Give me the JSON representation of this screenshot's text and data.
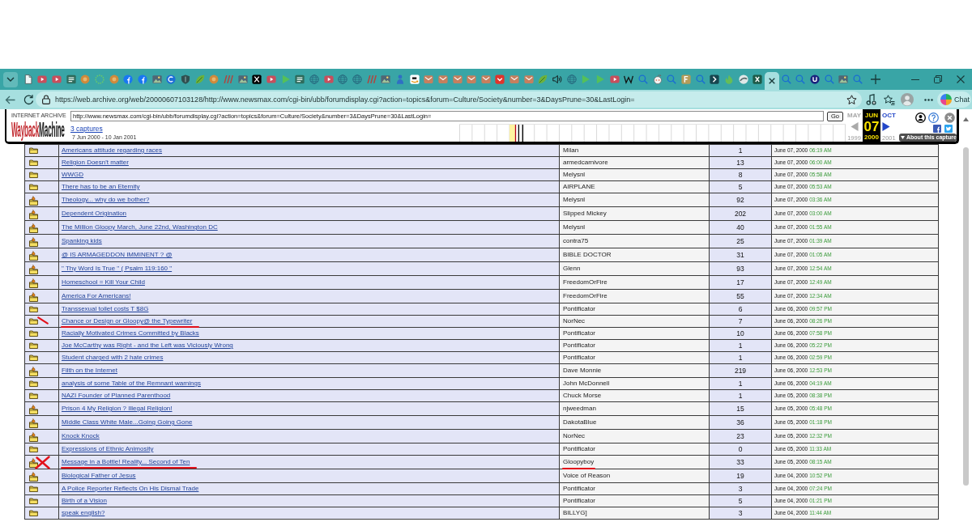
{
  "browser": {
    "tabs": [
      {
        "kind": "page",
        "selected": false
      },
      {
        "kind": "video",
        "selected": false
      },
      {
        "kind": "video",
        "selected": false
      },
      {
        "kind": "card",
        "selected": false
      },
      {
        "kind": "circle",
        "selected": false
      },
      {
        "kind": "dots",
        "selected": false
      },
      {
        "kind": "circle",
        "selected": false
      },
      {
        "kind": "f-circle",
        "selected": false
      },
      {
        "kind": "f-circle",
        "selected": false
      },
      {
        "kind": "image",
        "selected": false
      },
      {
        "kind": "ring",
        "selected": false
      },
      {
        "kind": "shield",
        "selected": false
      },
      {
        "kind": "leaf",
        "selected": false
      },
      {
        "kind": "circle",
        "selected": false
      },
      {
        "kind": "stripes",
        "selected": false
      },
      {
        "kind": "image",
        "selected": false
      },
      {
        "kind": "x",
        "selected": false
      },
      {
        "kind": "video",
        "selected": false
      },
      {
        "kind": "play",
        "selected": false
      },
      {
        "kind": "card",
        "selected": false
      },
      {
        "kind": "globe",
        "selected": false
      },
      {
        "kind": "video",
        "selected": false
      },
      {
        "kind": "globe",
        "selected": false
      },
      {
        "kind": "globe",
        "selected": false
      },
      {
        "kind": "stripes",
        "selected": false
      },
      {
        "kind": "image",
        "selected": false
      },
      {
        "kind": "person",
        "selected": false
      },
      {
        "kind": "smile-arrow",
        "selected": false
      },
      {
        "kind": "envelope",
        "selected": false
      },
      {
        "kind": "envelope",
        "selected": false
      },
      {
        "kind": "envelope",
        "selected": false
      },
      {
        "kind": "envelope",
        "selected": false
      },
      {
        "kind": "envelope",
        "selected": false
      },
      {
        "kind": "chevron",
        "selected": false
      },
      {
        "kind": "envelope",
        "selected": false
      },
      {
        "kind": "envelope",
        "selected": false
      },
      {
        "kind": "leaf",
        "selected": false
      },
      {
        "kind": "speaker",
        "selected": false
      },
      {
        "kind": "globe",
        "selected": false
      },
      {
        "kind": "play",
        "selected": false
      },
      {
        "kind": "play",
        "selected": false
      },
      {
        "kind": "video",
        "selected": false
      },
      {
        "kind": "w",
        "selected": false
      },
      {
        "kind": "search",
        "selected": false
      },
      {
        "kind": "face",
        "selected": false
      },
      {
        "kind": "search",
        "selected": false
      },
      {
        "kind": "f-square",
        "selected": false
      },
      {
        "kind": "search",
        "selected": false
      },
      {
        "kind": "arrow-box",
        "selected": false
      },
      {
        "kind": "flame",
        "selected": false
      },
      {
        "kind": "swoosh",
        "selected": false
      },
      {
        "kind": "x-box",
        "selected": false
      },
      {
        "selected": true
      },
      {
        "kind": "search",
        "selected": false
      },
      {
        "kind": "search",
        "selected": false
      },
      {
        "kind": "u-circle",
        "selected": false
      },
      {
        "kind": "search",
        "selected": false
      },
      {
        "kind": "image",
        "selected": false
      },
      {
        "kind": "search",
        "selected": false
      }
    ],
    "address": "https://web.archive.org/web/20000607103128/http://www.newsmax.com/cgi-bin/ubb/forumdisplay.cgi?action=topics&forum=Culture/Society&number=3&DaysPrune=30&LastLogin=",
    "chat": "Chat"
  },
  "wayback": {
    "logo": {
      "caption": "INTERNET ARCHIVE",
      "first": "Wayback",
      "second": "Machine"
    },
    "url": "http://www.newsmax.com/cgi-bin/ubb/forumdisplay.cgi?action=topics&forum=Culture/Society&number=3&DaysPrune=30&LastLogin=",
    "go": "Go",
    "captures": "3 captures",
    "range": "7 Jun 2000 - 10 Jan 2001",
    "prev": {
      "month": "MAY",
      "year": "1999",
      "enabled": false
    },
    "current": {
      "month": "JUN",
      "day": "07",
      "year": "2000"
    },
    "next": {
      "month": "OCT",
      "year": "2001",
      "enabled": true
    },
    "about": "About this capture"
  },
  "forum": {
    "topics": [
      {
        "kind": "folder",
        "title": "Americans attitude regarding races",
        "starter": "Milan",
        "replies": "1",
        "date": "June 07, 2000",
        "time": "06:19 AM",
        "underlined": false,
        "starter_underlined": false,
        "slashed": false,
        "crossed": false
      },
      {
        "kind": "folder",
        "title": "Religion Doesn't matter",
        "starter": "armedcarnivore",
        "replies": "13",
        "date": "June 07, 2000",
        "time": "06:00 AM",
        "underlined": false,
        "starter_underlined": false,
        "slashed": false,
        "crossed": false
      },
      {
        "kind": "folder",
        "title": "WWGD",
        "starter": "Melysnl",
        "replies": "8",
        "date": "June 07, 2000",
        "time": "05:58 AM",
        "underlined": false,
        "starter_underlined": false,
        "slashed": false,
        "crossed": false
      },
      {
        "kind": "folder",
        "title": "There has to be an Eternity",
        "starter": "AIRPLANE",
        "replies": "5",
        "date": "June 07, 2000",
        "time": "05:53 AM",
        "underlined": false,
        "starter_underlined": false,
        "slashed": false,
        "crossed": false
      },
      {
        "kind": "hot",
        "title": "Theology... why do we bother?",
        "starter": "Melysnl",
        "replies": "92",
        "date": "June 07, 2000",
        "time": "03:36 AM",
        "underlined": false,
        "starter_underlined": false,
        "slashed": false,
        "crossed": false
      },
      {
        "kind": "hot",
        "title": "Dependent Origination",
        "starter": "Slipped Mickey",
        "replies": "202",
        "date": "June 07, 2000",
        "time": "03:00 AM",
        "underlined": false,
        "starter_underlined": false,
        "slashed": false,
        "crossed": false
      },
      {
        "kind": "hot",
        "title": "The Million Gloopy March, June 22nd, Washington DC",
        "starter": "Melysnl",
        "replies": "40",
        "date": "June 07, 2000",
        "time": "01:55 AM",
        "underlined": false,
        "starter_underlined": false,
        "slashed": false,
        "crossed": false
      },
      {
        "kind": "hot",
        "title": "Spanking kids",
        "starter": "contra75",
        "replies": "25",
        "date": "June 07, 2000",
        "time": "01:39 AM",
        "underlined": false,
        "starter_underlined": false,
        "slashed": false,
        "crossed": false
      },
      {
        "kind": "hot",
        "title": "@ IS ARMAGEDDON IMMINENT ? @",
        "starter": "BIBLE DOCTOR",
        "replies": "31",
        "date": "June 07, 2000",
        "time": "01:05 AM",
        "underlined": false,
        "starter_underlined": false,
        "slashed": false,
        "crossed": false
      },
      {
        "kind": "hot",
        "title": "\" Thy Word Is True \" ( Psalm 119:160 \"",
        "starter": "Glenn",
        "replies": "93",
        "date": "June 07, 2000",
        "time": "12:54 AM",
        "underlined": false,
        "starter_underlined": false,
        "slashed": false,
        "crossed": false
      },
      {
        "kind": "hot",
        "title": "Homeschool = Kill Your Child",
        "starter": "FreedomOrFire",
        "replies": "17",
        "date": "June 07, 2000",
        "time": "12:49 AM",
        "underlined": false,
        "starter_underlined": false,
        "slashed": false,
        "crossed": false
      },
      {
        "kind": "hot",
        "title": "America For Americans!",
        "starter": "FreedomOrFire",
        "replies": "55",
        "date": "June 07, 2000",
        "time": "12:34 AM",
        "underlined": false,
        "starter_underlined": false,
        "slashed": false,
        "crossed": false
      },
      {
        "kind": "folder",
        "title": "Transsexual toilet costs T $8G",
        "starter": "Pontificator",
        "replies": "6",
        "date": "June 06, 2000",
        "time": "09:57 PM",
        "underlined": false,
        "starter_underlined": false,
        "slashed": false,
        "crossed": false
      },
      {
        "kind": "folder",
        "title": "Chance or Design or Gloopy@ the Typewriter",
        "starter": "NorNec",
        "replies": "7",
        "date": "June 06, 2000",
        "time": "08:26 PM",
        "underlined": true,
        "starter_underlined": false,
        "slashed": true,
        "crossed": false
      },
      {
        "kind": "folder",
        "title": "Racially Motivated Crimes Committed by Blacks",
        "starter": "Pontificator",
        "replies": "10",
        "date": "June 06, 2000",
        "time": "07:58 PM",
        "underlined": false,
        "starter_underlined": false,
        "slashed": false,
        "crossed": false
      },
      {
        "kind": "folder",
        "title": "Joe McCarthy was Right - and the Left was Viciously Wrong",
        "starter": "Pontificator",
        "replies": "1",
        "date": "June 06, 2000",
        "time": "05:22 PM",
        "underlined": false,
        "starter_underlined": false,
        "slashed": false,
        "crossed": false
      },
      {
        "kind": "folder",
        "title": "Student charged with 2 hate crimes",
        "starter": "Pontificator",
        "replies": "1",
        "date": "June 06, 2000",
        "time": "02:59 PM",
        "underlined": false,
        "starter_underlined": false,
        "slashed": false,
        "crossed": false
      },
      {
        "kind": "hot",
        "title": "Filth on the Internet",
        "starter": "Dave Monnie",
        "replies": "219",
        "date": "June 06, 2000",
        "time": "12:53 PM",
        "underlined": false,
        "starter_underlined": false,
        "slashed": false,
        "crossed": false
      },
      {
        "kind": "folder",
        "title": "analysis of some Table of the Remnant warnings",
        "starter": "John McDonnell",
        "replies": "1",
        "date": "June 06, 2000",
        "time": "04:19 AM",
        "underlined": false,
        "starter_underlined": false,
        "slashed": false,
        "crossed": false
      },
      {
        "kind": "folder",
        "title": "NAZI Founder of Planned Parenthood",
        "starter": "Chuck Morse",
        "replies": "1",
        "date": "June 05, 2000",
        "time": "08:38 PM",
        "underlined": false,
        "starter_underlined": false,
        "slashed": false,
        "crossed": false
      },
      {
        "kind": "hot",
        "title": "Prison 4 My Religion ? Illegal Religion!",
        "starter": "njweedman",
        "replies": "15",
        "date": "June 05, 2000",
        "time": "05:48 PM",
        "underlined": false,
        "starter_underlined": false,
        "slashed": false,
        "crossed": false
      },
      {
        "kind": "hot",
        "title": "Middle Class White Male...Going Going Gone",
        "starter": "DakotaBlue",
        "replies": "36",
        "date": "June 05, 2000",
        "time": "01:18 PM",
        "underlined": false,
        "starter_underlined": false,
        "slashed": false,
        "crossed": false
      },
      {
        "kind": "hot",
        "title": "Knock Knock",
        "starter": "NorNec",
        "replies": "23",
        "date": "June 05, 2000",
        "time": "12:32 PM",
        "underlined": false,
        "starter_underlined": false,
        "slashed": false,
        "crossed": false
      },
      {
        "kind": "folder",
        "title": "Expressions of Ethnic Animosity",
        "starter": "Pontificator",
        "replies": "0",
        "date": "June 05, 2000",
        "time": "11:33 AM",
        "underlined": false,
        "starter_underlined": false,
        "slashed": false,
        "crossed": false
      },
      {
        "kind": "hot",
        "title": "Message in a Bottle! Reality... Second of Ten",
        "starter": "Gloopyboy",
        "replies": "33",
        "date": "June 05, 2000",
        "time": "08:15 AM",
        "underlined": true,
        "starter_underlined": true,
        "slashed": false,
        "crossed": true
      },
      {
        "kind": "hot",
        "title": "Biological Father of Jesus",
        "starter": "Voice of Reason",
        "replies": "19",
        "date": "June 04, 2000",
        "time": "10:52 PM",
        "underlined": false,
        "starter_underlined": false,
        "slashed": false,
        "crossed": false
      },
      {
        "kind": "folder",
        "title": "A Police Reporter Reflects On His Dismal Trade",
        "starter": "Pontificator",
        "replies": "3",
        "date": "June 04, 2000",
        "time": "07:24 PM",
        "underlined": false,
        "starter_underlined": false,
        "slashed": false,
        "crossed": false
      },
      {
        "kind": "folder",
        "title": "Birth of a Vision",
        "starter": "Pontificator",
        "replies": "5",
        "date": "June 04, 2000",
        "time": "01:21 PM",
        "underlined": false,
        "starter_underlined": false,
        "slashed": false,
        "crossed": false
      },
      {
        "kind": "folder",
        "title": "speak english?",
        "starter": "BILLYG]",
        "replies": "3",
        "date": "June 04, 2000",
        "time": "11:44 AM",
        "underlined": false,
        "starter_underlined": false,
        "slashed": false,
        "crossed": false
      }
    ]
  }
}
